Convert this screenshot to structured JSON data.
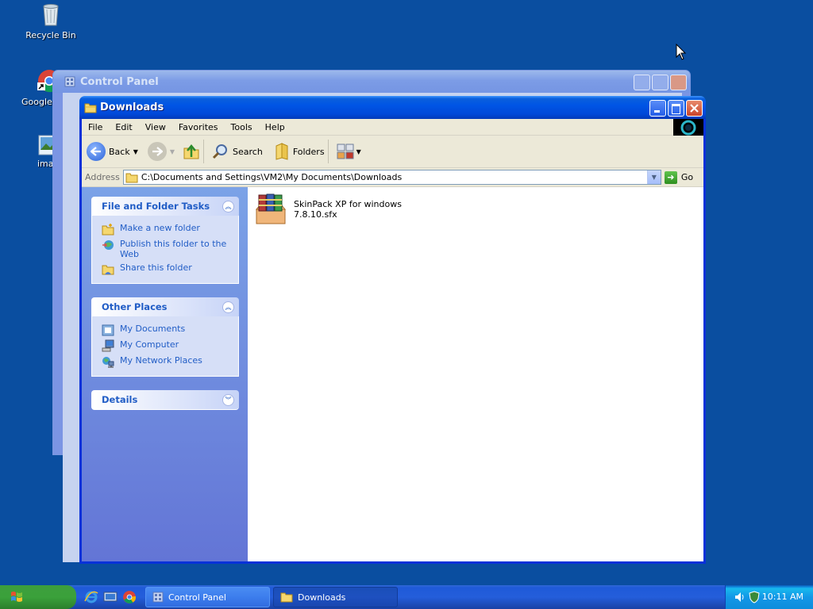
{
  "desktop": {
    "icons": [
      {
        "label": "Recycle Bin"
      },
      {
        "label": "Google C"
      },
      {
        "label": "imag"
      }
    ]
  },
  "bg_window": {
    "title": "Control Panel"
  },
  "window": {
    "title": "Downloads",
    "menu": [
      "File",
      "Edit",
      "View",
      "Favorites",
      "Tools",
      "Help"
    ],
    "toolbar": {
      "back": "Back",
      "search": "Search",
      "folders": "Folders"
    },
    "address": {
      "label": "Address",
      "value": "C:\\Documents and Settings\\VM2\\My Documents\\Downloads",
      "go": "Go"
    },
    "tasks": {
      "file_folder": {
        "title": "File and Folder Tasks",
        "items": [
          "Make a new folder",
          "Publish this folder to the Web",
          "Share this folder"
        ]
      },
      "other_places": {
        "title": "Other Places",
        "items": [
          "My Documents",
          "My Computer",
          "My Network Places"
        ]
      },
      "details": {
        "title": "Details"
      }
    },
    "files": [
      {
        "name_line1": "SkinPack XP for windows",
        "name_line2": "7.8.10.sfx",
        "icon": "winrar-archive-icon"
      }
    ]
  },
  "taskbar": {
    "tasks": [
      {
        "label": "Control Panel"
      },
      {
        "label": "Downloads"
      }
    ],
    "clock": "10:11 AM"
  },
  "colors": {
    "desktop": "#0a4ea0",
    "titlebar": "#0055e5",
    "task_link": "#215dc6",
    "start_green": "#3ba13b"
  }
}
